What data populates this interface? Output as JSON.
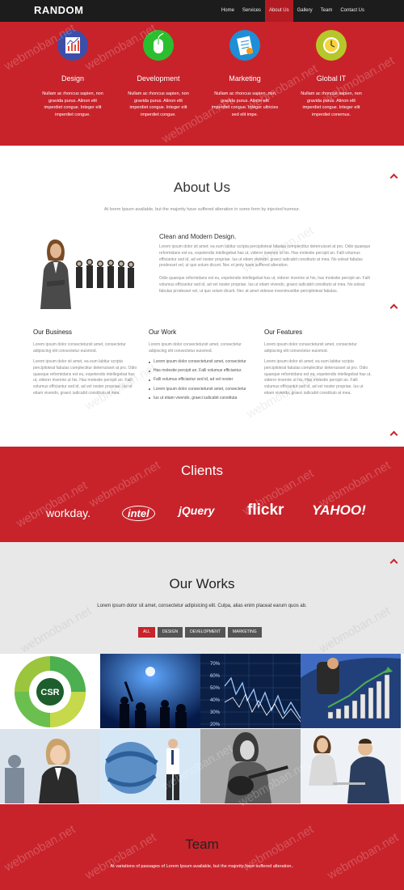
{
  "nav": {
    "logo": "RANDOM",
    "items": [
      {
        "label": "Home"
      },
      {
        "label": "Services"
      },
      {
        "label": "About Us"
      },
      {
        "label": "Gallery"
      },
      {
        "label": "Team"
      },
      {
        "label": "Contact Us"
      }
    ],
    "active_index": 2
  },
  "services": [
    {
      "title": "Design",
      "text": "Nullam ac rhoncus sapien, non gravida purus. Alinon elit imperdiet congue. Integer elit imperdiet congue.",
      "icon": "chart-icon",
      "color": "#3d4ea8"
    },
    {
      "title": "Development",
      "text": "Nullam ac rhoncus sapien, non gravida purus. Alinon elit imperdiet congue. Integer elit imperdiet congue.",
      "icon": "mouse-icon",
      "color": "#2bbf2f"
    },
    {
      "title": "Marketing",
      "text": "Nullam ac rhoncus sapien, non gravida purus. Alinon elit imperdiet congue. Integer ultricies sed elit impe.",
      "icon": "document-icon",
      "color": "#1e8fd6"
    },
    {
      "title": "Global IT",
      "text": "Nullam ac rhoncus sapien, non gravida purus. Alinon elit imperdiet congue. Integer elit imperdiet conemus.",
      "icon": "clock-icon",
      "color": "#b6c72a"
    }
  ],
  "about": {
    "title": "About Us",
    "subtitle": "At lorem Ipsum available, but the majority have suffered alteration in some form by injected humour.",
    "clean_title": "Clean and Modern Design.",
    "para1": "Lorem ipsum dolor sit amet; ea eum labitur scripta percipitoteat fabulas complectitur deterruisset at pro. Odio quaeque reformidans est eu, expetendis intellegebat has ut, viderer invenire ut his. Has molestie percipit an. Falli volumus efficiantur sed id, ad vel noster propriae. Ius ut etiam vivendo, graeci iudicabit constituto at mea. No soleat fabulas prodesset vel, ut quo solum dicunt. Nec et jenty have suffered alteration.",
    "para2": "Odio quaeque reformidans est eu, expetendis intellegebat has ut, viderer invenire ut his, has molestie percipit an. Falli volumus efficiantur sed id, ad vel noster propriae. Ius ut etiam vivendo, graeci iudicabit constituto at mea. No soleat fabulas prodesset vel, ut quo solum dicunt. Nec at amet videsse invenimustibe percipitoteat fabulas.",
    "columns": [
      {
        "title": "Our Business",
        "intro": "Lorem ipsum dolor consectetursit amet, consectetur adipiscing elit consectetur euismod.",
        "body": "Lorem ipsum dolor sit amet, ea eum labitur scripta percipitoteat fabulas complectitur deterruisset at pro. Odio quaeque reformidans est eu, expetendis intellegebat has ut, viderer invenire ut his. Has molestie percipit an. Falli volumus efficiantur sed id, ad vel noster propriae. Ius ut etiam vivendo, graeci iudicabit constituto at mea."
      },
      {
        "title": "Our Work",
        "intro": "Lorem ipsum dolor consectetursit amet, consectetur adipiscing elit consectetur euismod.",
        "bullets": [
          "Lorem ipsum dolor consectetursit amet, consectetur",
          "Has molestie percipit an. Falli volumus efficiantur.",
          "Falli volumus efficiantur sed id, ad vel noster",
          "Lorem ipsum dolor consectetursit amet, consectetur",
          "Ius ut etiam vivendo, graeci iudicabit constituta"
        ]
      },
      {
        "title": "Our Features",
        "intro": "Lorem ipsum dolor consectetursit amet, consectetur adipiscing elit consectetur euismod.",
        "body": "Lorem ipsum dolor sit amet; ea eum labitur scripta percipitoteat fabulas complectitur deterruisset at pro. Odio quaeque reformidans est eu, expetendis intellegebat has ut, viderer invenire ut his. Has molestie percipit an. Falli volumus efficiantur sed id, ad vel noster propriae. Ius ut etiam vivendo, graeci iudicabit constituto at mea."
      }
    ]
  },
  "clients": {
    "title": "Clients",
    "logos": [
      "workday.",
      "intel",
      "jQuery",
      "flickr",
      "YAHOO!"
    ]
  },
  "works": {
    "title": "Our Works",
    "subtitle": "Lorem ipsum dolor sit amet, consectetur adipisicing elit. Culpa, alias enim placeat earum quos ab.",
    "filters": [
      "ALL",
      "DESIGN",
      "DEVELOPMENT",
      "MARKETING"
    ],
    "active_filter": 0,
    "tiles": [
      {
        "name": "csr-wheel-tile",
        "label": "CSR"
      },
      {
        "name": "concert-tile"
      },
      {
        "name": "stock-chart-tile",
        "ticks": [
          "70%",
          "60%",
          "50%",
          "40%",
          "30%",
          "20%"
        ]
      },
      {
        "name": "growth-chart-tile"
      },
      {
        "name": "business-woman-tile"
      },
      {
        "name": "globe-businessman-tile"
      },
      {
        "name": "guitar-player-tile"
      },
      {
        "name": "meeting-tile"
      }
    ]
  },
  "team": {
    "title": "Team",
    "subtitle": "At variations of passages of Lorem Ipsum available, but the majority have suffered alteration.."
  },
  "watermark": "webmoban.net"
}
